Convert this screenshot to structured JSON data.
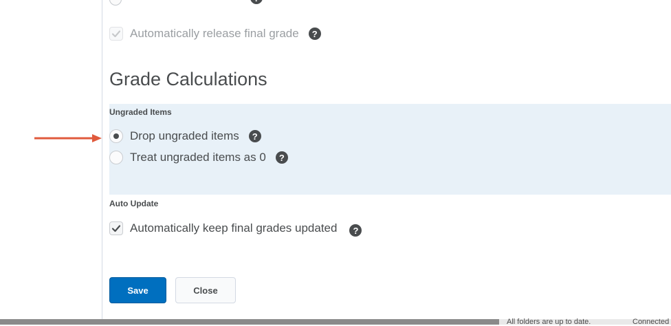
{
  "top": {
    "release_label": "Automatically release final grade"
  },
  "grade_calculations": {
    "title": "Grade Calculations",
    "ungraded_items": {
      "group_label": "Ungraded Items",
      "options": [
        {
          "label": "Drop ungraded items",
          "selected": true
        },
        {
          "label": "Treat ungraded items as 0",
          "selected": false
        }
      ]
    },
    "auto_update": {
      "group_label": "Auto Update",
      "keep_updated_label": "Automatically keep final grades updated",
      "checked": true
    }
  },
  "buttons": {
    "save_label": "Save",
    "close_label": "Close"
  },
  "status_bar": {
    "sync_text": "All folders are up to date.",
    "connection_text": "Connected"
  },
  "help_icon": "?",
  "colors": {
    "primary": "#006fbf",
    "panel_highlight": "#e8f1f8",
    "arrow": "#e05a3c"
  }
}
